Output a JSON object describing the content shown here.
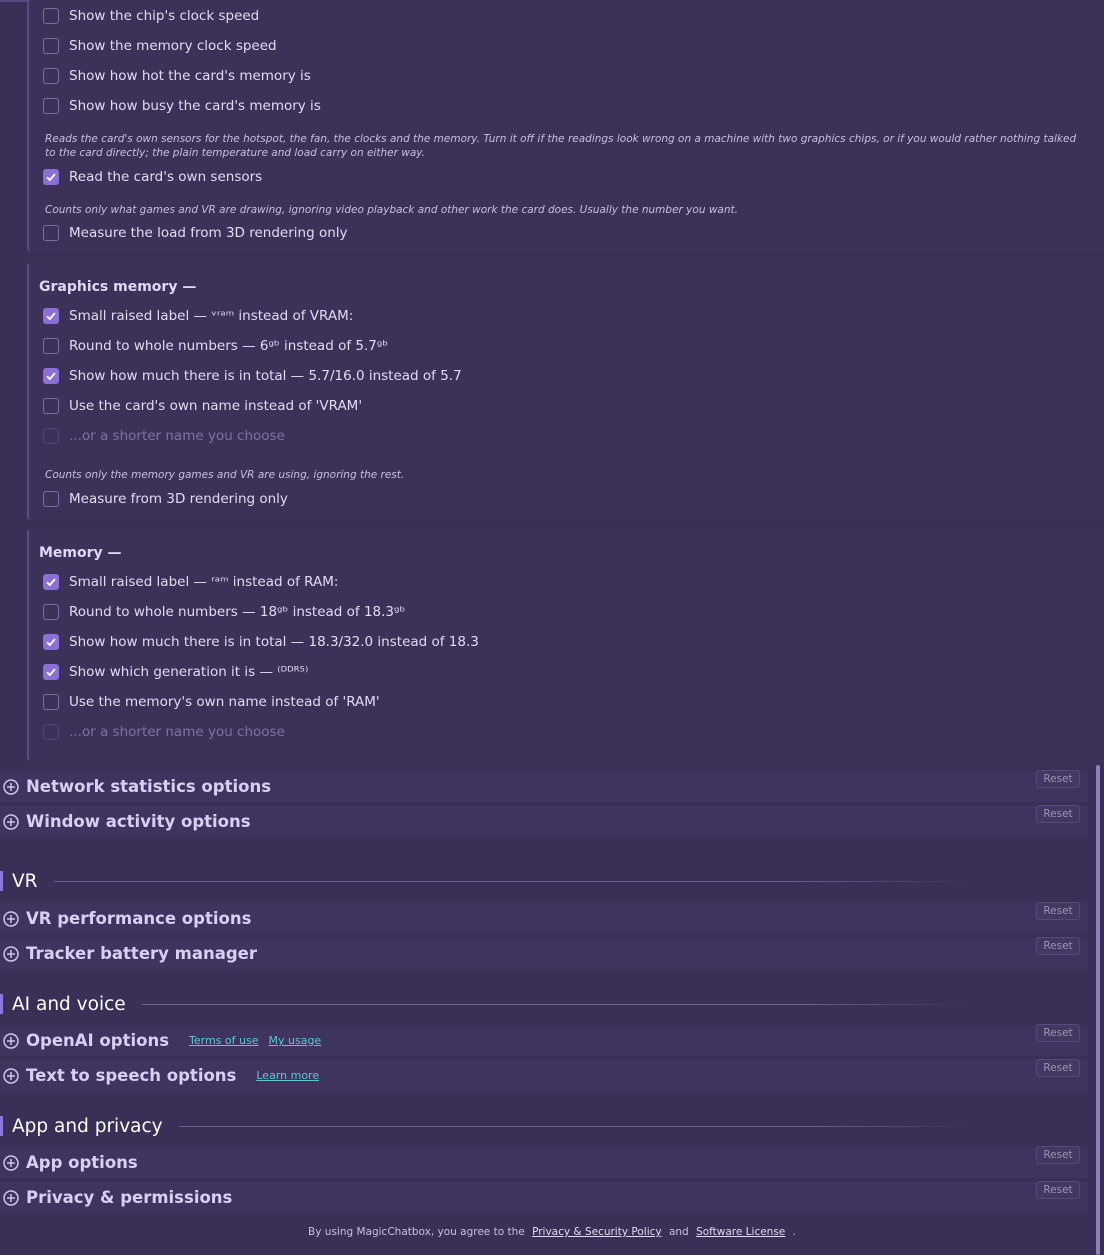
{
  "gpu_core": {
    "rows": [
      {
        "label": "Show the chip's clock speed",
        "checked": false,
        "disabled": false
      },
      {
        "label": "Show the memory clock speed",
        "checked": false,
        "disabled": false
      },
      {
        "label": "Show how hot the card's memory is",
        "checked": false,
        "disabled": false
      },
      {
        "label": "Show how busy the card's memory is",
        "checked": false,
        "disabled": false
      }
    ],
    "sensors_hint": "Reads the card's own sensors for the hotspot, the fan, the clocks and the memory. Turn it off if the readings look wrong on a machine with two graphics chips, or if you would rather nothing talked to the card directly; the plain temperature and load carry on either way.",
    "sensors_row": {
      "label": "Read the card's own sensors",
      "checked": true,
      "disabled": false
    },
    "load_hint": "Counts only what games and VR are drawing, ignoring video playback and other work the card does. Usually the number you want.",
    "load_row": {
      "label": "Measure the load from 3D rendering only",
      "checked": false,
      "disabled": false
    }
  },
  "graphics_memory": {
    "title": "Graphics memory —",
    "rows": [
      {
        "label": "Small raised label — ᵛʳᵃᵐ instead of VRAM:",
        "checked": true,
        "disabled": false
      },
      {
        "label": "Round to whole numbers — 6ᵍᵇ instead of 5.7ᵍᵇ",
        "checked": false,
        "disabled": false
      },
      {
        "label": "Show how much there is in total — 5.7/16.0 instead of 5.7",
        "checked": true,
        "disabled": false
      },
      {
        "label": "Use the card's own name instead of 'VRAM'",
        "checked": false,
        "disabled": false
      },
      {
        "label": "...or a shorter name you choose",
        "checked": false,
        "disabled": true
      }
    ],
    "hint": "Counts only the memory games and VR are using, ignoring the rest.",
    "extra_row": {
      "label": "Measure from 3D rendering only",
      "checked": false,
      "disabled": false
    }
  },
  "memory": {
    "title": "Memory —",
    "rows": [
      {
        "label": "Small raised label — ʳᵃᵐ instead of RAM:",
        "checked": true,
        "disabled": false
      },
      {
        "label": "Round to whole numbers — 18ᵍᵇ instead of 18.3ᵍᵇ",
        "checked": false,
        "disabled": false
      },
      {
        "label": "Show how much there is in total — 18.3/32.0 instead of 18.3",
        "checked": true,
        "disabled": false
      },
      {
        "label": "Show which generation it is — ⁽ᴰᴰᴿ⁵⁾",
        "checked": true,
        "disabled": false
      },
      {
        "label": "Use the memory's own name instead of 'RAM'",
        "checked": false,
        "disabled": false
      },
      {
        "label": "...or a shorter name you choose",
        "checked": false,
        "disabled": true
      }
    ]
  },
  "sections": {
    "network": {
      "title": "Network statistics options",
      "reset": "Reset"
    },
    "window_activity": {
      "title": "Window activity options",
      "reset": "Reset"
    },
    "vr_performance": {
      "title": "VR performance options",
      "reset": "Reset"
    },
    "tracker_battery": {
      "title": "Tracker battery manager",
      "reset": "Reset"
    },
    "openai": {
      "title": "OpenAI options",
      "reset": "Reset",
      "links": [
        "Terms of use",
        "My usage"
      ]
    },
    "tts": {
      "title": "Text to speech options",
      "reset": "Reset",
      "links": [
        "Learn more"
      ]
    },
    "app": {
      "title": "App options",
      "reset": "Reset"
    },
    "privacy": {
      "title": "Privacy & permissions",
      "reset": "Reset"
    }
  },
  "categories": {
    "vr": "VR",
    "ai_voice": "AI and voice",
    "app_privacy": "App and privacy"
  },
  "footer": {
    "prefix": "By using MagicChatbox, you agree to the",
    "privacy_link": "Privacy & Security Policy",
    "and": "and",
    "license_link": "Software License",
    "suffix": "."
  },
  "colors": {
    "background": "#3a2f56",
    "accent": "#8b6fd6",
    "link": "#5fc7d2"
  },
  "icons": {
    "expand": "circle-plus-icon",
    "check": "checkmark-icon"
  }
}
